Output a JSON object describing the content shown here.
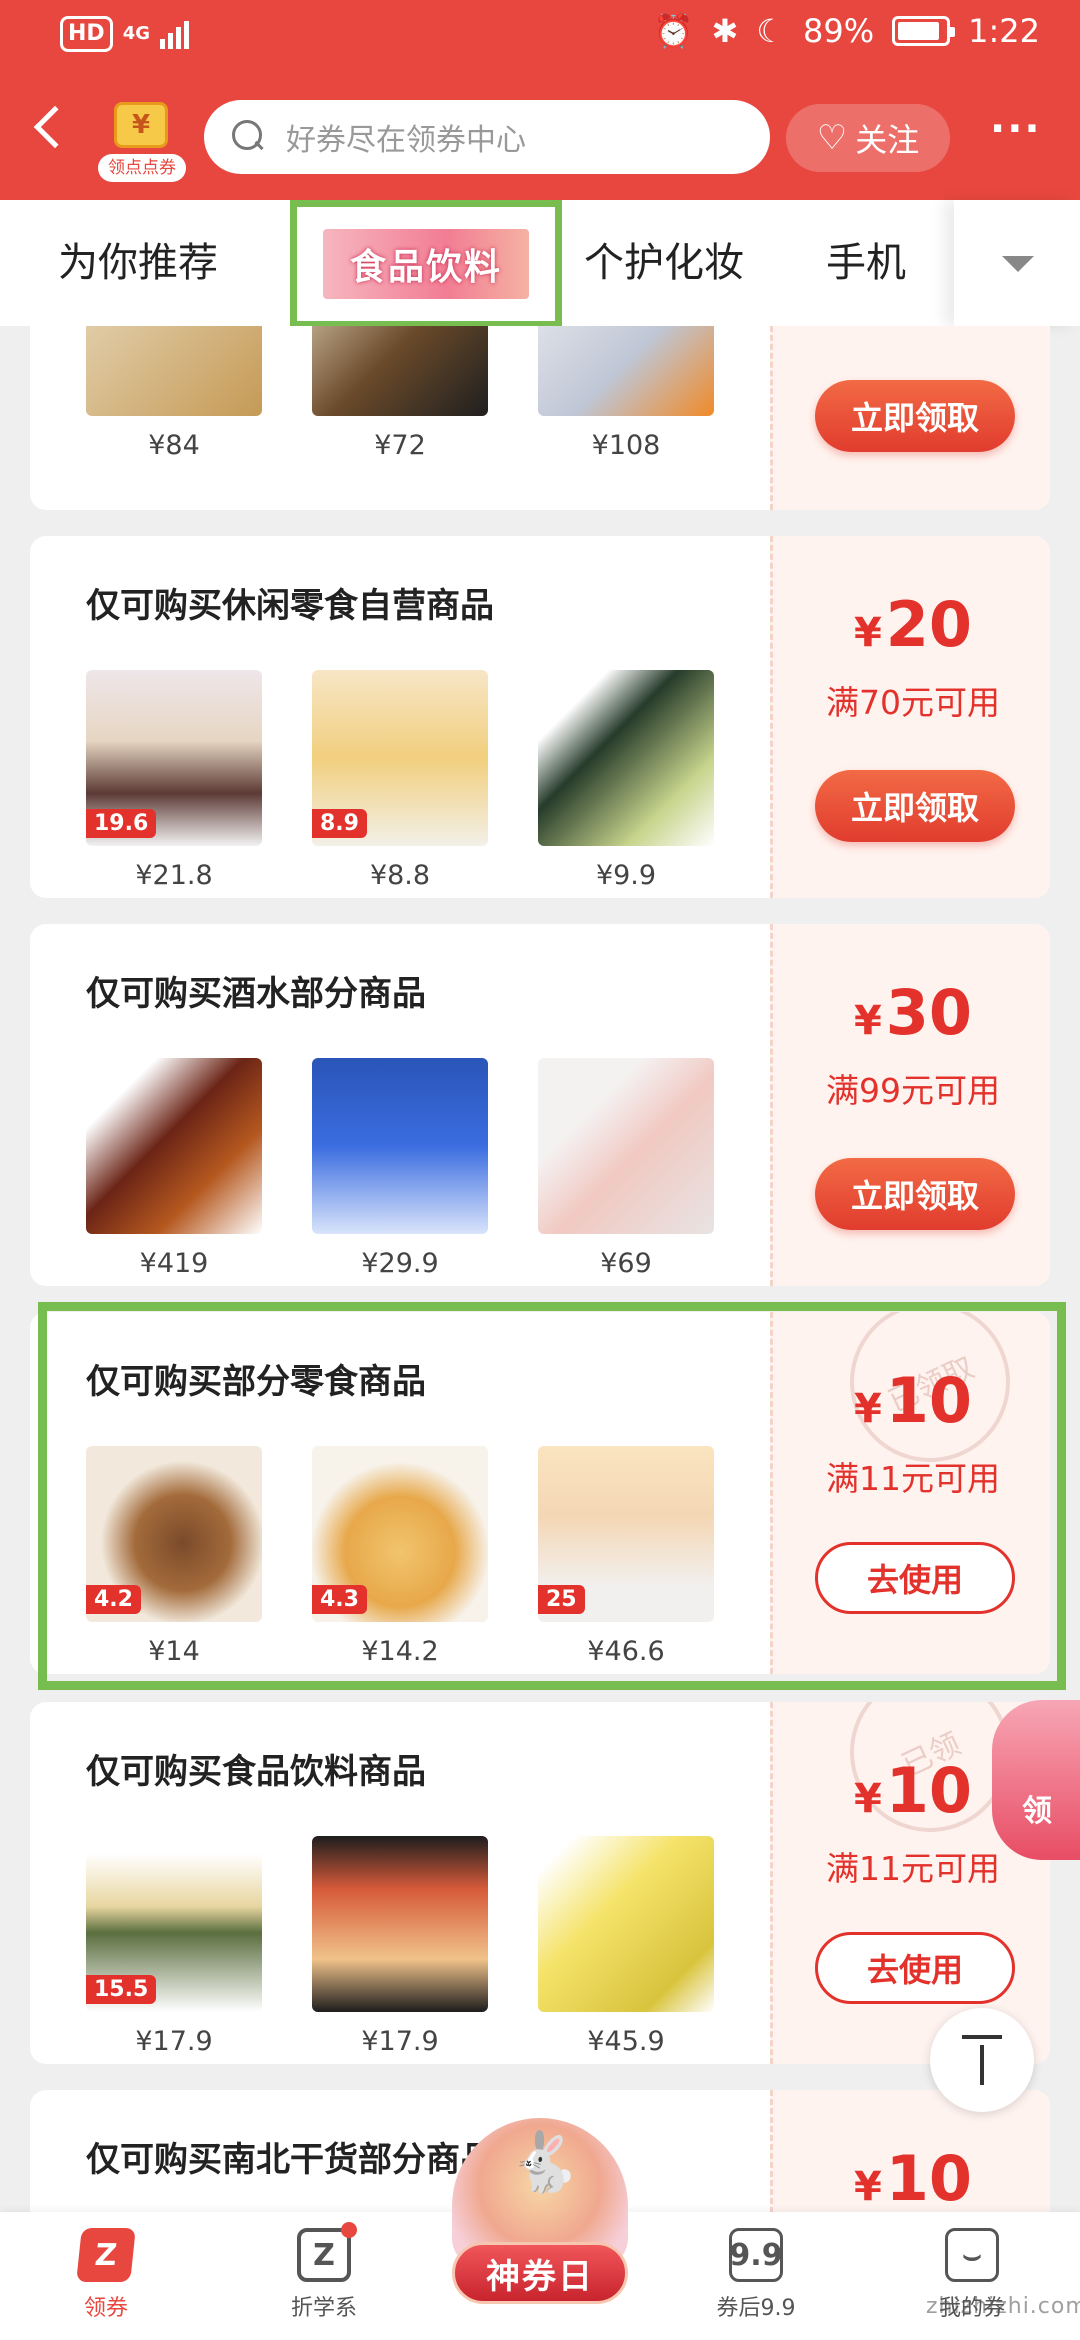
{
  "status_bar": {
    "hd": "HD",
    "network": "4G",
    "battery_pct": "89%",
    "time": "1:22"
  },
  "header": {
    "logo_symbol": "¥",
    "logo_label": "领点点券",
    "search_placeholder": "好券尽在领券中心",
    "follow_label": "关注",
    "more_label": "···"
  },
  "tabs": [
    {
      "label": "为你推荐",
      "active": false
    },
    {
      "label": "食品饮料",
      "active": true
    },
    {
      "label": "个护化妆",
      "active": false
    },
    {
      "label": "手机",
      "active": false
    }
  ],
  "cards": [
    {
      "title": "",
      "amount": "",
      "condition": "",
      "button": "立即领取",
      "claimed": false,
      "products": [
        {
          "price": "¥84"
        },
        {
          "price": "¥72"
        },
        {
          "price": "¥108"
        }
      ]
    },
    {
      "title": "仅可购买休闲零食自营商品",
      "currency": "¥",
      "amount": "20",
      "condition": "满70元可用",
      "button": "立即领取",
      "claimed": false,
      "products": [
        {
          "price": "¥21.8",
          "tag": "19.6"
        },
        {
          "price": "¥8.8",
          "tag": "8.9"
        },
        {
          "price": "¥9.9"
        }
      ]
    },
    {
      "title": "仅可购买酒水部分商品",
      "currency": "¥",
      "amount": "30",
      "condition": "满99元可用",
      "button": "立即领取",
      "claimed": false,
      "products": [
        {
          "price": "¥419"
        },
        {
          "price": "¥29.9"
        },
        {
          "price": "¥69"
        }
      ]
    },
    {
      "title": "仅可购买部分零食商品",
      "currency": "¥",
      "amount": "10",
      "condition": "满11元可用",
      "button": "去使用",
      "claimed": true,
      "stamp": "已领取",
      "products": [
        {
          "price": "¥14",
          "tag": "4.2"
        },
        {
          "price": "¥14.2",
          "tag": "4.3"
        },
        {
          "price": "¥46.6",
          "tag": "25"
        }
      ]
    },
    {
      "title": "仅可购买食品饮料商品",
      "currency": "¥",
      "amount": "10",
      "condition": "满11元可用",
      "button": "去使用",
      "claimed": true,
      "stamp": "已领",
      "products": [
        {
          "price": "¥17.9",
          "tag": "15.5"
        },
        {
          "price": "¥17.9"
        },
        {
          "price": "¥45.9"
        }
      ]
    },
    {
      "title": "仅可购买南北干货部分商品",
      "currency": "¥",
      "amount": "10"
    }
  ],
  "float_banner": "领",
  "bottom_nav": {
    "items": [
      {
        "label": "领券",
        "icon": "coupon-icon",
        "active": true
      },
      {
        "label": "折学系",
        "icon": "z-icon"
      },
      {
        "label": "券后9.9",
        "icon": "99-icon",
        "icon_text": "9.9"
      },
      {
        "label": "我的券",
        "icon": "mine-icon"
      }
    ],
    "center_label": "神券日"
  },
  "watermark": "zhizhizhi.com"
}
